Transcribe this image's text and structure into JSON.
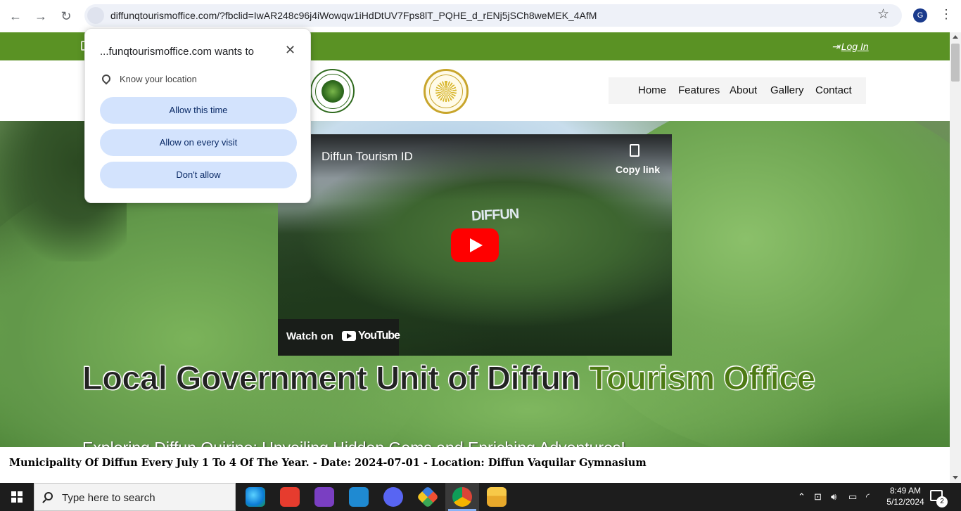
{
  "browser": {
    "url": "diffunqtourismoffice.com/?fbclid=IwAR248c96j4iWowqw1iHdDtUV7Fps8lT_PQHE_d_rENj5jSCh8weMEK_4AfM",
    "profile_initial": "G"
  },
  "permission_prompt": {
    "title": "...funqtourismoffice.com wants to",
    "description": "Know your location",
    "allow_once": "Allow this time",
    "allow_always": "Allow on every visit",
    "deny": "Don't allow"
  },
  "topbar": {
    "login_label": "Log In"
  },
  "nav": {
    "items": [
      "Home",
      "Features",
      "About",
      "Gallery",
      "Contact"
    ]
  },
  "video": {
    "channel_title": "Diffun Tourism ID",
    "copy_link": "Copy link",
    "watch_on": "Watch on",
    "youtube": "YouTube",
    "sign_text": "DIFFUN"
  },
  "hero": {
    "title_main": "Local Government Unit of Diffun ",
    "title_accent": "Tourism Office",
    "subtitle": "Exploring Diffun Quirino: Unveiling Hidden Gems and Enriching Adventures!"
  },
  "ticker": {
    "text": "Municipality Of Diffun Every July 1 To 4 Of The Year. - Date: 2024-07-01 - Location: Diffun Vaquilar Gymnasium"
  },
  "taskbar": {
    "search_placeholder": "Type here to search",
    "time": "8:49 AM",
    "date": "5/12/2024",
    "notification_count": "2",
    "apps": [
      "edge-icon",
      "wps-icon",
      "visual-studio-icon",
      "vscode-icon",
      "discord-icon",
      "git-icon",
      "chrome-icon",
      "file-explorer-icon"
    ]
  },
  "colors": {
    "brand_green": "#5a9224",
    "title_green": "#4d7a14",
    "prompt_button": "#d3e3fd"
  }
}
